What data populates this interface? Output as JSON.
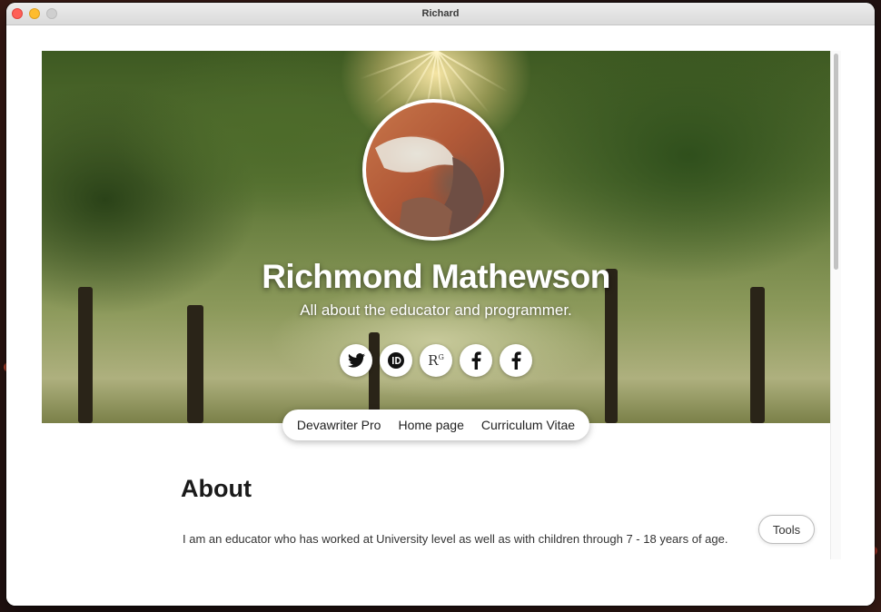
{
  "window": {
    "title": "Richard"
  },
  "profile": {
    "name": "Richmond Mathewson",
    "tagline": "All about the educator and programmer."
  },
  "socials": [
    {
      "icon": "twitter-icon"
    },
    {
      "icon": "orcid-icon"
    },
    {
      "icon": "researchgate-icon",
      "label": "R",
      "sup": "G"
    },
    {
      "icon": "facebook-icon"
    },
    {
      "icon": "facebook-icon"
    }
  ],
  "nav": {
    "items": [
      "Devawriter Pro",
      "Home page",
      "Curriculum Vitae"
    ]
  },
  "about": {
    "heading": "About",
    "text": "I am an educator who has worked at University level as well as with children through 7 - 18 years of age."
  },
  "tools": {
    "label": "Tools"
  },
  "colors": {
    "close": "#fe5f57",
    "minimize": "#febc2e",
    "maximize": "#cfcfcf"
  }
}
